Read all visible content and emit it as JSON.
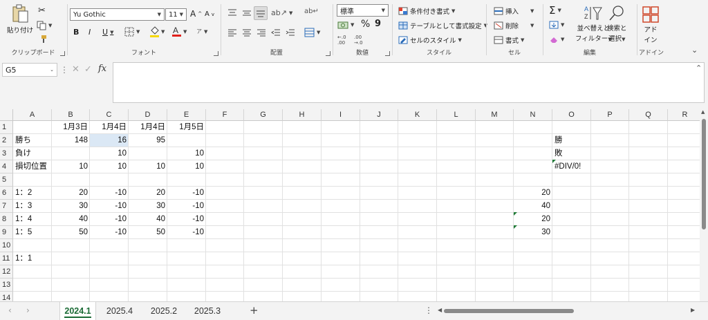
{
  "ribbon": {
    "clipboard": {
      "paste_label": "貼り付け",
      "group_label": "クリップボード"
    },
    "font": {
      "font_name": "Yu Gothic",
      "font_size": "11",
      "bold": "B",
      "italic": "I",
      "underline": "U",
      "group_label": "フォント",
      "grow": "A",
      "shrink": "A"
    },
    "alignment": {
      "group_label": "配置"
    },
    "number": {
      "format": "標準",
      "percent": "%",
      "comma": "9",
      "group_label": "数値"
    },
    "styles": {
      "conditional": "条件付き書式",
      "table": "テーブルとして書式設定",
      "cell_styles": "セルのスタイル",
      "group_label": "スタイル"
    },
    "cells": {
      "insert": "挿入",
      "delete": "削除",
      "format": "書式",
      "group_label": "セル"
    },
    "editing": {
      "sigma": "Σ",
      "sort_filter_1": "並べ替えと",
      "sort_filter_2": "フィルター",
      "find_1": "検索と",
      "find_2": "選択",
      "group_label": "編集"
    },
    "addins": {
      "label_1": "アド",
      "label_2": "イン",
      "group_label": "アドイン"
    },
    "icons": [
      "paste-icon",
      "cut-icon",
      "copy-icon",
      "format-painter-icon",
      "border-icon",
      "fill-color-icon",
      "font-color-icon",
      "phonetic-icon",
      "align-icon",
      "orientation-icon",
      "wrap-text-icon",
      "merge-icon",
      "currency-icon",
      "decimal-icon",
      "conditional-format-icon",
      "table-format-icon",
      "cell-style-icon",
      "insert-icon",
      "delete-icon",
      "format-icon",
      "autosum-icon",
      "fill-icon",
      "clear-icon",
      "sort-icon",
      "find-icon",
      "addins-icon",
      "collapse-ribbon-icon"
    ]
  },
  "formula_bar": {
    "name_box": "G5",
    "fx": "fx",
    "cancel": "✕",
    "enter": "✓",
    "content": ""
  },
  "columns": [
    "A",
    "B",
    "C",
    "D",
    "E",
    "F",
    "G",
    "H",
    "I",
    "J",
    "K",
    "L",
    "M",
    "N",
    "O",
    "P",
    "Q",
    "R"
  ],
  "rows": [
    "1",
    "2",
    "3",
    "4",
    "5",
    "6",
    "7",
    "8",
    "9",
    "10",
    "11",
    "12",
    "13",
    "14"
  ],
  "cells": {
    "B1": "1月3日",
    "C1": "1月4日",
    "D1": "1月4日",
    "E1": "1月5日",
    "A2": "勝ち",
    "B2": "148",
    "C2": "16",
    "D2": "95",
    "O2": "勝",
    "A3": "負け",
    "C3": "10",
    "E3": "10",
    "O3": "敗",
    "A4": "損切位置",
    "B4": "10",
    "C4": "10",
    "D4": "10",
    "E4": "10",
    "O4": "#DIV/0!",
    "A6": "1：2",
    "B6": "20",
    "C6": "-10",
    "D6": "20",
    "E6": "-10",
    "N6": "20",
    "A7": "1：3",
    "B7": "30",
    "C7": "-10",
    "D7": "30",
    "E7": "-10",
    "N7": "40",
    "A8": "1：4",
    "B8": "40",
    "C8": "-10",
    "D8": "40",
    "E8": "-10",
    "N8": "20",
    "A9": "1：5",
    "B9": "50",
    "C9": "-10",
    "D9": "50",
    "E9": "-10",
    "N9": "30",
    "A11": "1：1"
  },
  "sheet_tabs": [
    "2024.1",
    "2025.4",
    "2025.2",
    "2025.3"
  ],
  "active_tab": "2024.1",
  "add_sheet": "+"
}
